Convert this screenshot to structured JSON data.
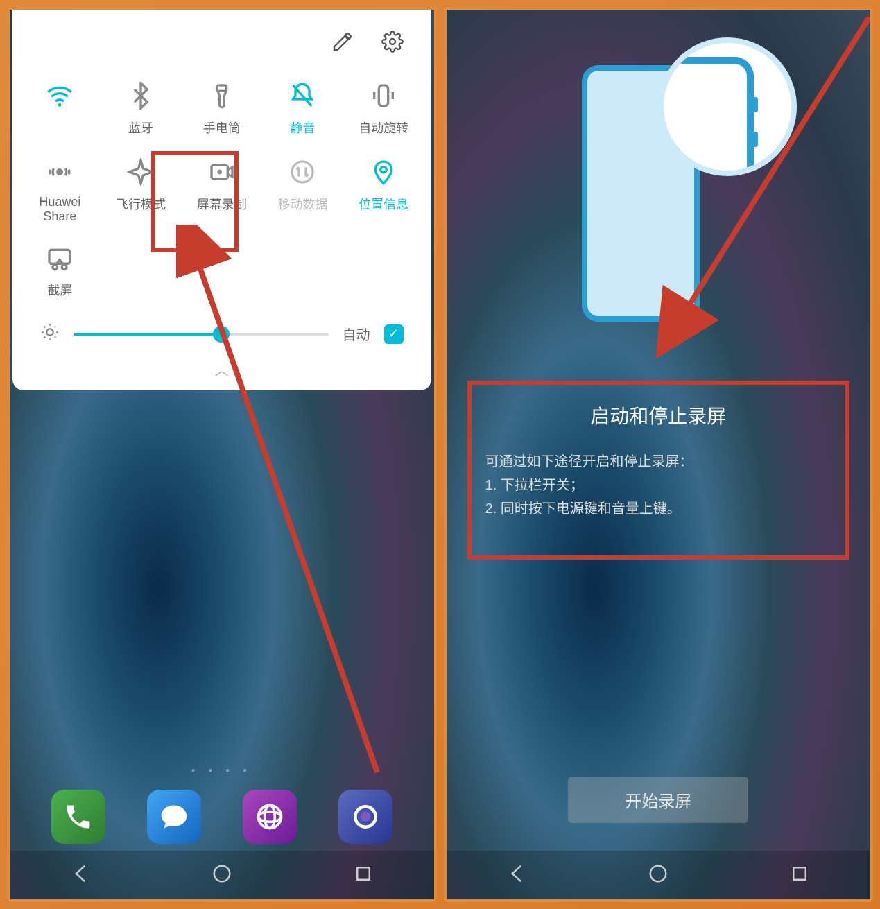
{
  "left": {
    "tiles": [
      {
        "label": "",
        "mode": "wifi"
      },
      {
        "label": "蓝牙",
        "mode": ""
      },
      {
        "label": "手电筒",
        "mode": ""
      },
      {
        "label": "静音",
        "mode": "active"
      },
      {
        "label": "自动旋转",
        "mode": ""
      },
      {
        "label": "Huawei Share",
        "mode": ""
      },
      {
        "label": "飞行模式",
        "mode": ""
      },
      {
        "label": "屏幕录制",
        "mode": ""
      },
      {
        "label": "移动数据",
        "mode": "disabled"
      },
      {
        "label": "位置信息",
        "mode": "active"
      },
      {
        "label": "截屏",
        "mode": ""
      }
    ],
    "brightness_auto_label": "自动"
  },
  "right": {
    "title": "启动和停止录屏",
    "line0": "可通过如下途径开启和停止录屏：",
    "line1": "1. 下拉栏开关；",
    "line2": "2. 同时按下电源键和音量上键。",
    "start_button": "开始录屏"
  }
}
